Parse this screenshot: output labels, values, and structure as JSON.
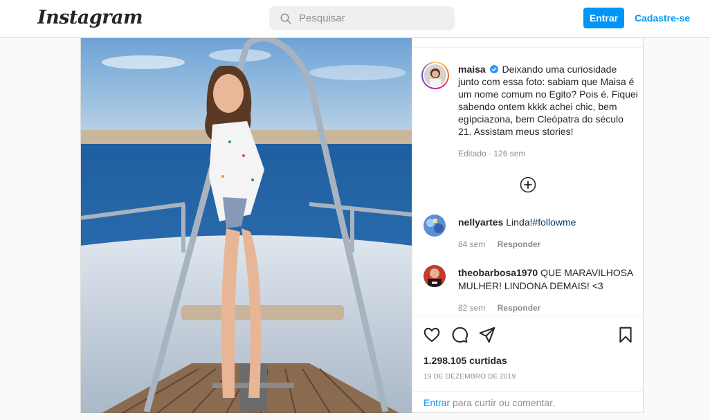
{
  "header": {
    "logo": "Instagram",
    "search_placeholder": "Pesquisar",
    "login_label": "Entrar",
    "signup_label": "Cadastre-se"
  },
  "post": {
    "author": "maisa",
    "caption": "Deixando uma curiosidade junto com essa foto: sabiam que Maisa é um nome comum no Egito? Pois é. Fiquei sabendo ontem kkkk achei chic, bem egípciazona, bem Cleópatra do século 21. Assistam meus stories!",
    "edited_label": "Editado",
    "age": "126 sem",
    "likes": "1.298.105 curtidas",
    "date": "19 DE DEZEMBRO DE 2019"
  },
  "comments": [
    {
      "user": "nellyartes",
      "text": "Linda!",
      "hashtag": "#followme",
      "age": "84 sem",
      "reply_label": "Responder"
    },
    {
      "user": "theobarbosa1970",
      "text": "QUE MARAVILHOSA MULHER! LINDONA DEMAIS! <3",
      "age": "82 sem",
      "reply_label": "Responder"
    }
  ],
  "footer": {
    "login_link": "Entrar",
    "login_suffix": "para curtir ou comentar."
  },
  "icons": {
    "search": "search-icon",
    "verified": "verified-badge-icon",
    "more": "add-circle-icon",
    "like": "heart-icon",
    "comment": "comment-icon",
    "share": "share-icon",
    "save": "bookmark-icon"
  },
  "colors": {
    "accent": "#0095f6",
    "hashtag": "#00376b"
  }
}
